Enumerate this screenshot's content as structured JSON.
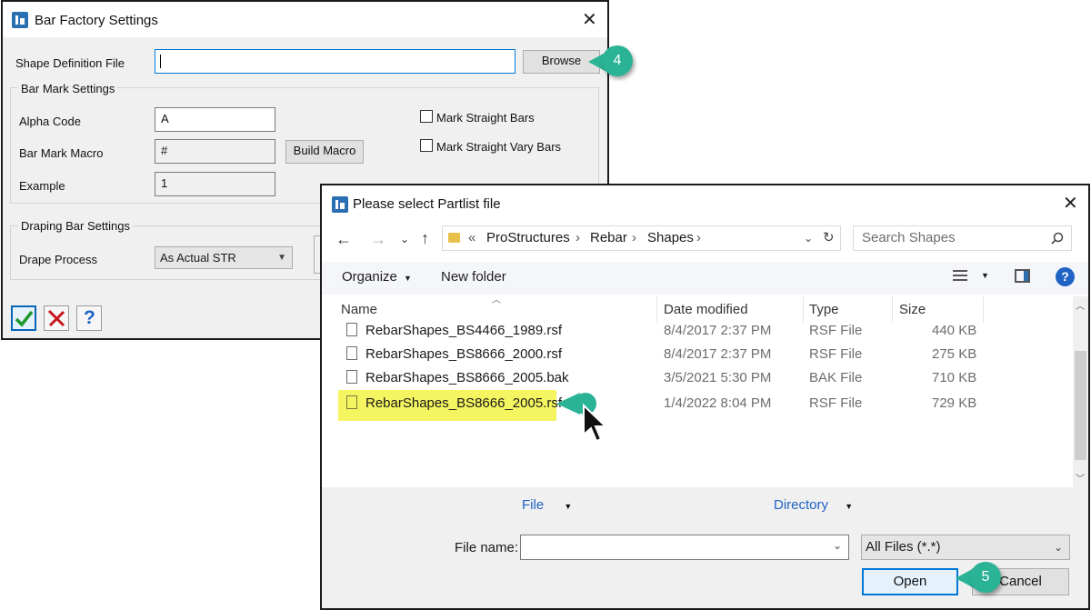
{
  "dialog1": {
    "title": "Bar Factory Settings",
    "shape_definition_label": "Shape Definition File",
    "shape_definition_value": "",
    "browse_label": "Browse",
    "bar_mark_group": "Bar Mark Settings",
    "alpha_code_label": "Alpha Code",
    "alpha_code_value": "A",
    "bar_mark_macro_label": "Bar Mark Macro",
    "bar_mark_macro_value": "#",
    "build_macro_label": "Build Macro",
    "example_label": "Example",
    "example_value": "1",
    "mark_straight_bars": "Mark Straight Bars",
    "mark_straight_vary_bars": "Mark Straight Vary Bars",
    "draping_group": "Draping Bar Settings",
    "drape_process_label": "Drape Process",
    "drape_process_value": "As Actual STR"
  },
  "callouts": {
    "step4": "4",
    "step5": "5"
  },
  "dialog2": {
    "title": "Please select Partlist file",
    "breadcrumb": [
      "ProStructures",
      "Rebar",
      "Shapes"
    ],
    "breadcrumb_prefix": "«",
    "search_placeholder": "Search Shapes",
    "organize_label": "Organize",
    "new_folder_label": "New folder",
    "columns": {
      "name": "Name",
      "date": "Date modified",
      "type": "Type",
      "size": "Size"
    },
    "files": [
      {
        "name": "RebarShapes_BS4466_1989.rsf",
        "date": "8/4/2017 2:37 PM",
        "type": "RSF File",
        "size": "440 KB"
      },
      {
        "name": "RebarShapes_BS8666_2000.rsf",
        "date": "8/4/2017 2:37 PM",
        "type": "RSF File",
        "size": "275 KB"
      },
      {
        "name": "RebarShapes_BS8666_2005.bak",
        "date": "3/5/2021 5:30 PM",
        "type": "BAK File",
        "size": "710 KB"
      },
      {
        "name": "RebarShapes_BS8666_2005.rsf",
        "date": "1/4/2022 8:04 PM",
        "type": "RSF File",
        "size": "729 KB"
      }
    ],
    "file_dropdown": "File",
    "directory_dropdown": "Directory",
    "file_name_label": "File name:",
    "file_name_value": "",
    "filter_value": "All Files (*.*)",
    "open_label": "Open",
    "cancel_label": "Cancel"
  },
  "colors": {
    "callout": "#2bb395",
    "highlight": "#f4f560",
    "accent": "#0078d7"
  }
}
